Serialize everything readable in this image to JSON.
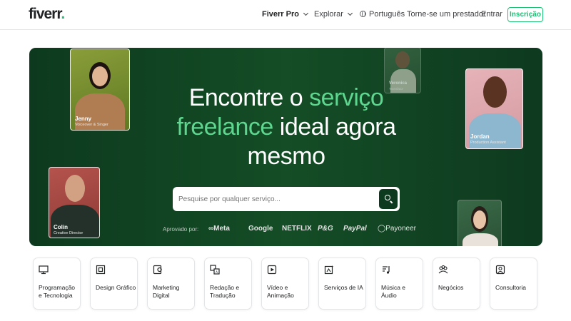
{
  "nav": {
    "logo": "fiverr",
    "logo_dot": ".",
    "fiverr_pro": "Fiverr Pro",
    "explore": "Explorar",
    "language": "Português",
    "become_seller": "Torne-se um prestador",
    "sign_in": "Entrar",
    "join": "Inscrição"
  },
  "hero": {
    "title_part1": "Encontre o ",
    "title_accent1": "serviço",
    "title_accent2": "freelance",
    "title_part2": " ideal agora",
    "title_part3": "mesmo",
    "search_placeholder": "Pesquise por qualquer serviço...",
    "trusted_by": "Aprovado por:",
    "brands": [
      "∞Meta",
      "Google",
      "NETFLIX",
      "P&G",
      "PayPal",
      "◯Payoneer"
    ]
  },
  "profiles": [
    {
      "name": "Jenny",
      "role": "Voiceover & Singer"
    },
    {
      "name": "Veronica",
      "role": "Translator"
    },
    {
      "name": "Jordan",
      "role": "Production Assistant"
    },
    {
      "name": "Colin",
      "role": "Creative Director"
    }
  ],
  "categories": [
    {
      "label": "Programação e Tecnologia",
      "icon": "monitor-icon"
    },
    {
      "label": "Design Gráfico",
      "icon": "design-icon"
    },
    {
      "label": "Marketing Digital",
      "icon": "marketing-icon"
    },
    {
      "label": "Redação e Tradução",
      "icon": "translation-icon"
    },
    {
      "label": "Vídeo e Animação",
      "icon": "video-icon"
    },
    {
      "label": "Serviços de IA",
      "icon": "ai-icon"
    },
    {
      "label": "Música e Áudio",
      "icon": "music-icon"
    },
    {
      "label": "Negócios",
      "icon": "business-icon"
    },
    {
      "label": "Consultoria",
      "icon": "consulting-icon"
    }
  ],
  "colors": {
    "brand_green": "#1dbf73",
    "hero_bg": "#0d3a1e",
    "accent_text": "#5fd68f"
  }
}
